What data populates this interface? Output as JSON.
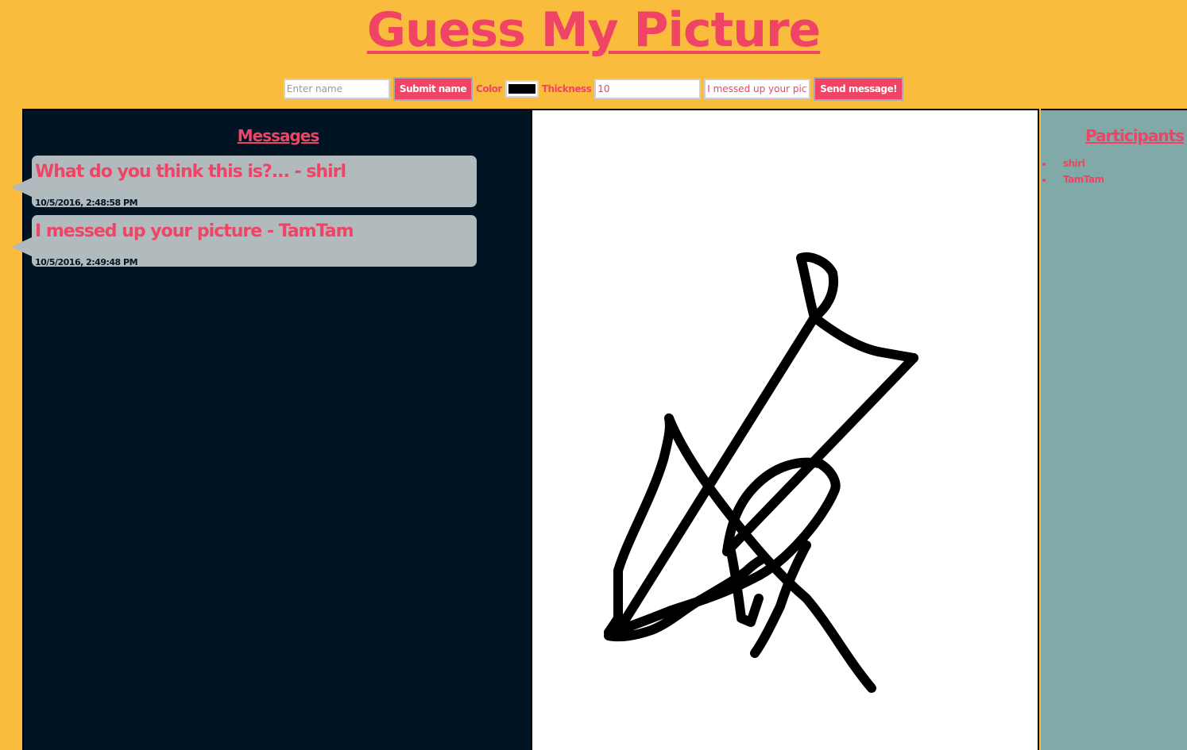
{
  "app": {
    "title": "Guess My Picture"
  },
  "controls": {
    "name_placeholder": "Enter name",
    "submit_name_label": "Submit name",
    "color_label": "Color",
    "color_value": "#000000",
    "thickness_label": "Thickness",
    "thickness_value": "10",
    "message_value": "I messed up your pictur",
    "send_label": "Send message!"
  },
  "messages": {
    "heading": "Messages",
    "items": [
      {
        "text": "What do you think this is?... - shirl",
        "time": "10/5/2016, 2:48:58 PM"
      },
      {
        "text": "I messed up your picture - TamTam",
        "time": "10/5/2016, 2:49:48 PM"
      }
    ]
  },
  "participants": {
    "heading": "Participants",
    "items": [
      "shirl",
      "TamTam"
    ]
  },
  "colors": {
    "background": "#F9BC3D",
    "accent": "#EF4465",
    "messages_bg": "#001423",
    "bubble_bg": "#B1BABD",
    "participants_bg": "#81A9A7"
  }
}
